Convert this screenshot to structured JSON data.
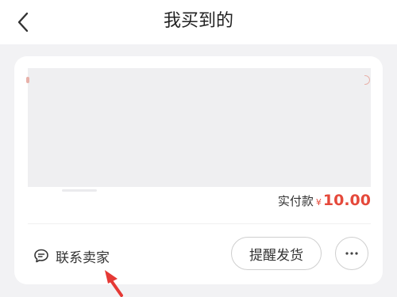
{
  "header": {
    "title": "我买到的",
    "back_icon": "chevron-left-icon"
  },
  "order": {
    "price_label": "实付款",
    "currency_symbol": "¥",
    "amount": "10.00",
    "accent_color": "#e5493b"
  },
  "actions": {
    "contact_seller_label": "联系卖家",
    "contact_icon": "chat-bubble-icon",
    "remind_shipping_label": "提醒发货",
    "more_icon": "more-horizontal-icon"
  },
  "annotation": {
    "arrow_icon": "red-arrow-icon",
    "arrow_color": "#e53935"
  }
}
